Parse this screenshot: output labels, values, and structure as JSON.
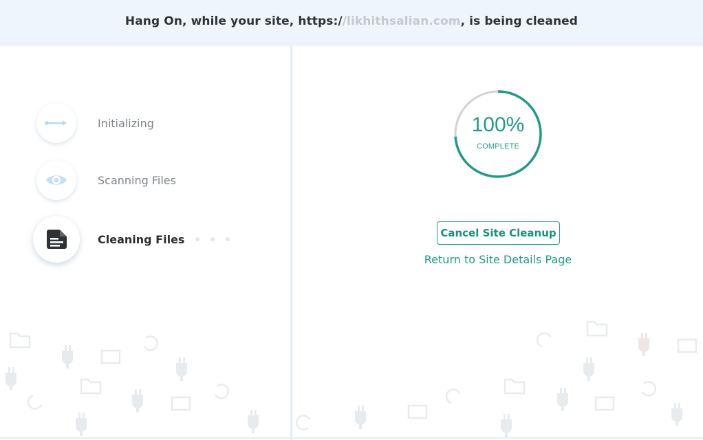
{
  "banner": {
    "prefix": "Hang On, while your site, https:/",
    "masked_url": "/likhithsalian.com",
    "suffix": ", is being cleaned"
  },
  "steps": [
    {
      "label": "Initializing",
      "icon": "arrow-line-icon",
      "state": "done"
    },
    {
      "label": "Scanning Files",
      "icon": "eye-icon",
      "state": "done"
    },
    {
      "label": "Cleaning Files",
      "icon": "document-icon",
      "state": "active"
    }
  ],
  "progress": {
    "percent_text": "100%",
    "status_label": "COMPLETE",
    "fraction": 1.0
  },
  "actions": {
    "cancel_label": "Cancel Site Cleanup",
    "return_label": "Return to Site Details Page"
  },
  "colors": {
    "accent": "#229a87",
    "banner_bg": "#eef5fd",
    "light_blue": "#dbe8f5"
  }
}
